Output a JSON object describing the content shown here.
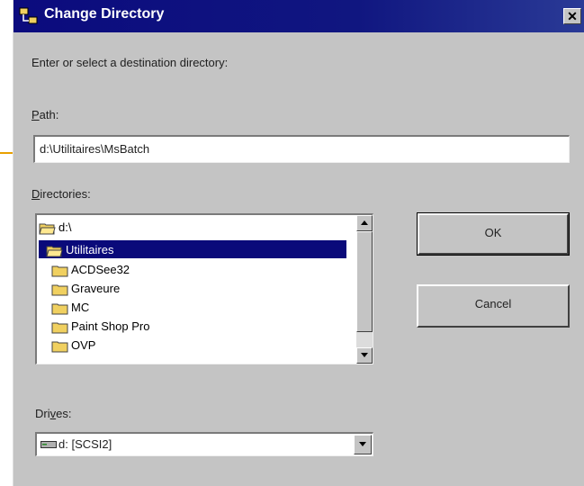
{
  "window": {
    "title": "Change Directory",
    "close_label": "✕"
  },
  "prompt": "Enter or select a destination directory:",
  "path": {
    "label_hot": "P",
    "label_rest": "ath:",
    "value": "d:\\Utilitaires\\MsBatch"
  },
  "directories": {
    "label_hot": "D",
    "label_rest": "irectories:",
    "items": [
      {
        "name": "d:\\",
        "selected": false,
        "open": true
      },
      {
        "name": "Utilitaires",
        "selected": true,
        "open": true
      },
      {
        "name": "ACDSee32",
        "selected": false,
        "open": false
      },
      {
        "name": "Graveure",
        "selected": false,
        "open": false
      },
      {
        "name": "MC",
        "selected": false,
        "open": false
      },
      {
        "name": "Paint Shop Pro",
        "selected": false,
        "open": false
      },
      {
        "name": "OVP",
        "selected": false,
        "open": false
      }
    ]
  },
  "drives": {
    "label_pre": "Dri",
    "label_hot": "v",
    "label_rest": "es:",
    "selected": "d: [SCSI2]"
  },
  "buttons": {
    "ok": "OK",
    "cancel": "Cancel"
  },
  "colors": {
    "titlebar": "#0b0b7e",
    "selection": "#0a0a7a",
    "folder": "#f0d060",
    "dialog": "#c4c4c4"
  }
}
